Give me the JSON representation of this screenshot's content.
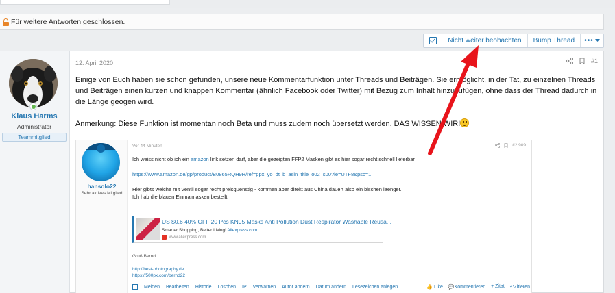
{
  "locked_notice": "Für weitere Antworten geschlossen.",
  "toolbar": {
    "unwatch": "Nicht weiter beobachten",
    "bump": "Bump Thread",
    "more": "•••"
  },
  "post": {
    "date": "12. April 2020",
    "number": "#1",
    "user": {
      "name": "Klaus Harms",
      "title": "Administrator",
      "banner": "Teammitglied"
    },
    "paragraph1": "Einige von Euch haben sie schon gefunden, unsere neue Kommentarfunktion unter Threads und Beiträgen. Sie ermöglicht, in der Tat, zu einzelnen Threads und Beiträgen einen kurzen und knappen Kommentar (ähnlich Facebook oder Twitter) mit Bezug zum Inhalt hinzuzufügen, ohne dass der Thread dadurch in die Länge geogen wird.",
    "paragraph2": "Anmerkung: Diese Funktion ist momentan noch Beta und muss zudem noch übersetzt werden. DAS WISSEN WIR!"
  },
  "embed": {
    "date": "Vor 44 Minuten",
    "number": "#2.909",
    "user": {
      "name": "hansolo22",
      "title": "Sehr aktives Mitglied"
    },
    "line1_pre": "Ich weiss nicht ob ich ein ",
    "line1_link": "amazon",
    "line1_post": " link setzen darf, aber die gezeigten FFP2 Masken gibt es hier sogar recht schnell lieferbar.",
    "url": "https://www.amazon.de/gp/product/B0865RQH9H/ref=ppx_yo_dt_b_asin_title_o02_s00?ie=UTF8&psc=1",
    "line3": "Hier gibts welche mit Ventil sogar recht preisguenstig - kommen aber direkt aus China dauert also ein bischen laenger.",
    "line4": "Ich hab die blauen Einmalmasken bestellt.",
    "card": {
      "title": "US $0.6 40% OFF|20 Pcs KN95 Masks Anti Pollution Dust Respirator Washable Reusa...",
      "sub_pre": "Smarter Shopping, Better Living! ",
      "sub_link": "Aliexpress.com",
      "url": "www.aliexpress.com"
    },
    "greeting": "Gruß Bernd",
    "sig1": "http://best-photography.de",
    "sig2": "https://500px.com/bernd22",
    "footer": {
      "melden": "Melden",
      "bearbeiten": "Bearbeiten",
      "historie": "Historie",
      "loeschen": "Löschen",
      "ip": "IP",
      "verwarnen": "Verwarnen",
      "autor": "Autor ändern",
      "datum": "Datum ändern",
      "lesezeichen": "Lesezeichen anlegen",
      "like": "Like",
      "kommentieren": "Kommentieren",
      "zitat": "+ Zitat",
      "zitieren": "Zitieren"
    }
  },
  "colors": {
    "accent": "#2577b1",
    "arrow": "#e8141b",
    "lock": "#e8862a"
  }
}
